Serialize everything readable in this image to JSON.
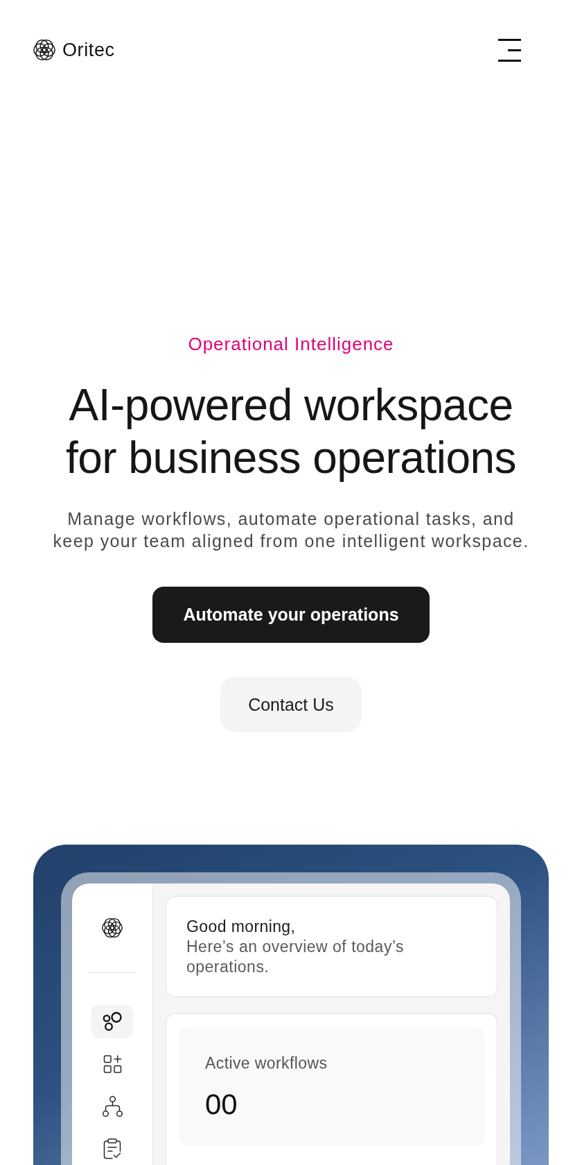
{
  "header": {
    "brand": "Oritec"
  },
  "hero": {
    "eyebrow": "Operational Intelligence",
    "headline": "AI-powered workspace for business operations",
    "subtitle": "Manage workflows, automate operational tasks, and keep your team aligned from one intelligent workspace.",
    "buttons": [
      {
        "label": "Automate your operations",
        "kind": "primary"
      },
      {
        "label": "Contact Us",
        "kind": "secondary"
      }
    ]
  },
  "dashboard": {
    "sidebar": {
      "items": [
        {
          "kind": "nodes",
          "selected": true
        },
        {
          "kind": "apps",
          "selected": false
        },
        {
          "kind": "flow",
          "selected": false
        },
        {
          "kind": "tasks",
          "selected": false
        }
      ]
    },
    "greeting": {
      "title": "Good morning,",
      "text": "Here’s an overview of today’s operations."
    },
    "stats": [
      {
        "label": "Active workflows",
        "value": "00"
      }
    ]
  }
}
